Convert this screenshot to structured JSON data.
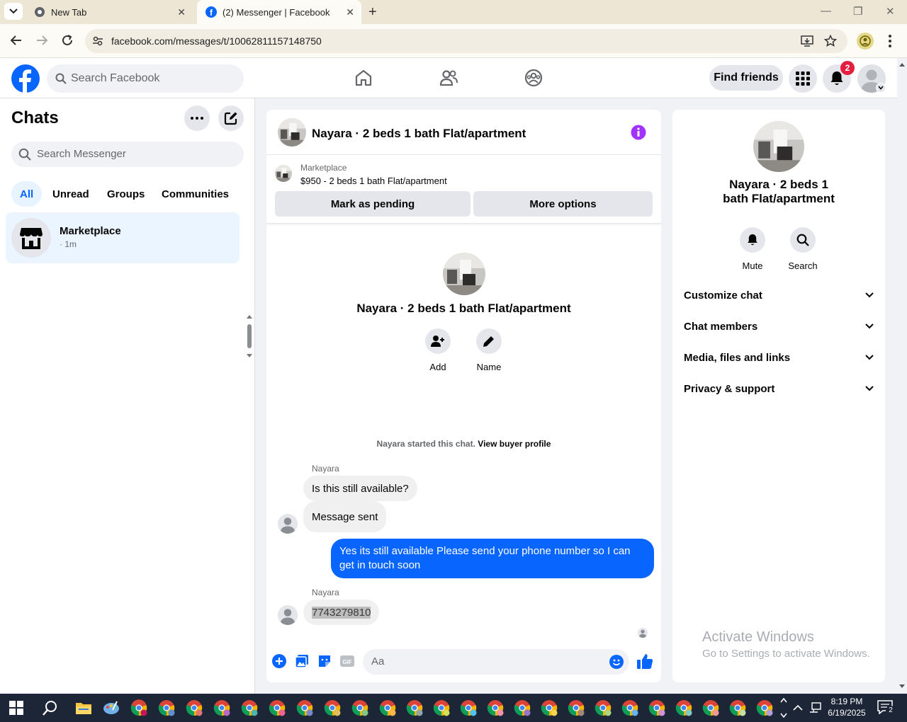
{
  "browser": {
    "tabs": [
      {
        "title": "New Tab"
      },
      {
        "title": "(2) Messenger | Facebook"
      }
    ],
    "url": "facebook.com/messages/t/10062811157148750"
  },
  "header": {
    "search_placeholder": "Search Facebook",
    "find_friends": "Find friends",
    "notification_count": "2"
  },
  "chats": {
    "title": "Chats",
    "search_placeholder": "Search Messenger",
    "filters": [
      "All",
      "Unread",
      "Groups",
      "Communities"
    ],
    "items": [
      {
        "name": "Marketplace",
        "meta": "· 1m"
      }
    ]
  },
  "conversation": {
    "title": "Nayara · 2 beds 1 bath Flat/apartment",
    "marketplace_label": "Marketplace",
    "listing": "$950 - 2 beds 1 bath Flat/apartment",
    "mark_pending": "Mark as pending",
    "more_options": "More options",
    "intro_title": "Nayara · 2 beds 1 bath Flat/apartment",
    "intro_actions": [
      "Add",
      "Name"
    ],
    "started_text": "Nayara started this chat.",
    "view_profile": "View buyer profile",
    "messages": [
      {
        "sender": "Nayara",
        "text": "Is this still available?"
      },
      {
        "text": "Message sent"
      },
      {
        "text": "Yes its still available Please send your phone number so I can get in touch soon"
      },
      {
        "sender": "Nayara",
        "text": "7743279810"
      }
    ],
    "composer_placeholder": "Aa"
  },
  "info_panel": {
    "title": "Nayara · 2 beds 1 bath Flat/apartment",
    "actions": [
      "Mute",
      "Search"
    ],
    "sections": [
      "Customize chat",
      "Chat members",
      "Media, files and links",
      "Privacy & support"
    ]
  },
  "watermark": {
    "line1": "Activate Windows",
    "line2": "Go to Settings to activate Windows."
  },
  "taskbar": {
    "time": "8:19 PM",
    "date": "6/19/2025",
    "notification_count": "2"
  },
  "colors": {
    "facebook_blue": "#0866ff",
    "messenger_purple": "#a033ff",
    "badge_red": "#e41e3f"
  }
}
